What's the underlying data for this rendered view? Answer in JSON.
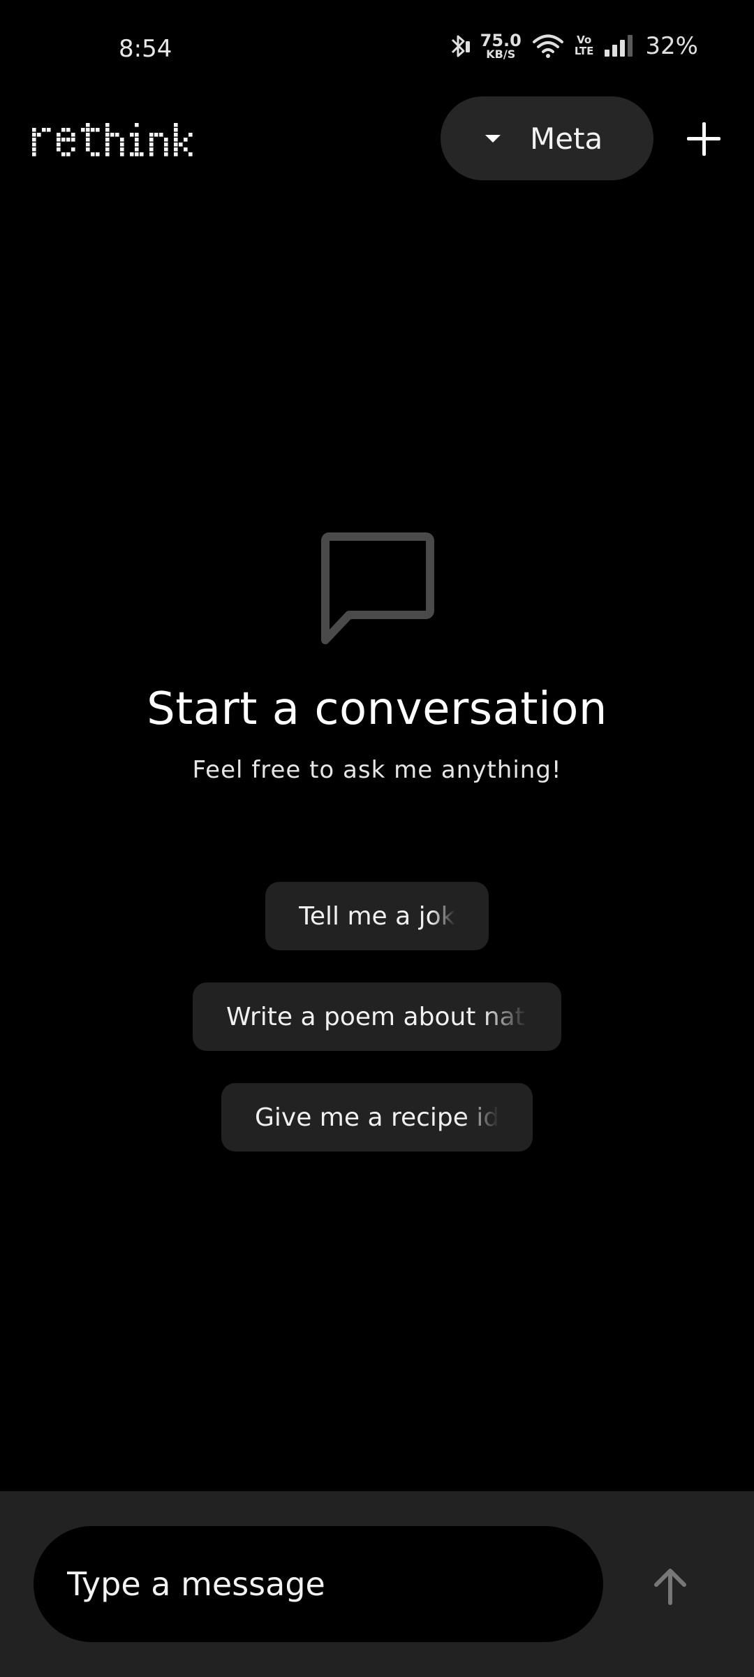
{
  "status_bar": {
    "time": "8:54",
    "net_speed_value": "75.0",
    "net_speed_unit": "KB/S",
    "volte_top": "Vo",
    "volte_bottom": "LTE",
    "battery": "32%",
    "icons": [
      "bluetooth-icon",
      "wifi-icon",
      "signal-icon"
    ]
  },
  "header": {
    "logo_text": "rethink",
    "model_label": "Meta",
    "new_chat_icon": "plus-icon"
  },
  "empty_state": {
    "icon": "chat-bubble-icon",
    "title": "Start a conversation",
    "subtitle": "Feel free to ask me anything!"
  },
  "suggestions": [
    {
      "label": "Tell me a joke"
    },
    {
      "label": "Write a poem about nature"
    },
    {
      "label": "Give me a recipe idea"
    }
  ],
  "composer": {
    "placeholder": "Type a message",
    "send_icon": "arrow-up-icon"
  },
  "colors": {
    "background": "#000000",
    "surface": "#222222",
    "pill": "#262626",
    "icon_muted": "#4a4a4a",
    "send_icon": "#777777"
  }
}
